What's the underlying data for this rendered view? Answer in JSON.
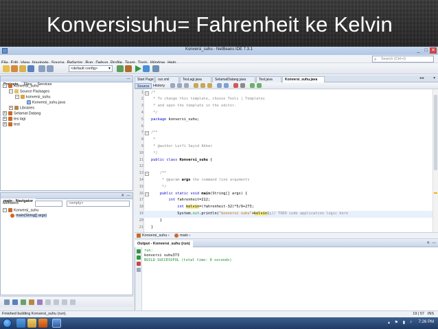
{
  "slide": {
    "title": "Konversisuhu= Fahrenheit ke Kelvin"
  },
  "window": {
    "title": "Konversi_suhu - NetBeans IDE 7.3.1",
    "minimize": "_",
    "maximize": "□",
    "close": "✕"
  },
  "menu": [
    "File",
    "Edit",
    "View",
    "Navigate",
    "Source",
    "Refactor",
    "Run",
    "Debug",
    "Profile",
    "Team",
    "Tools",
    "Window",
    "Help"
  ],
  "search": {
    "placeholder": "Search (Ctrl+I)"
  },
  "toolbar": {
    "config": "<default config>"
  },
  "projects_panel": {
    "tabs": [
      "Projects",
      "Files",
      "Services"
    ],
    "tree": [
      {
        "label": "Konversi_suhu",
        "icon": "coffee-icon",
        "depth": 0
      },
      {
        "label": "Source Packages",
        "icon": "folder-icon",
        "depth": 1
      },
      {
        "label": "konversi_suhu",
        "icon": "package-icon",
        "depth": 2
      },
      {
        "label": "Konversi_suhu.java",
        "icon": "java-file-icon",
        "depth": 3
      },
      {
        "label": "Libraries",
        "icon": "library-icon",
        "depth": 1
      },
      {
        "label": "Selamat Datang",
        "icon": "coffee-icon",
        "depth": 0
      },
      {
        "label": "tes lagi",
        "icon": "coffee-icon",
        "depth": 0
      },
      {
        "label": "test",
        "icon": "coffee-icon",
        "depth": 0
      }
    ]
  },
  "navigator_panel": {
    "title": "main - Navigator",
    "filter_label": "Members",
    "filter_value": "<empty>",
    "tree": [
      {
        "label": "Konversi_suhu",
        "depth": 0
      },
      {
        "label": "main(String[] args)",
        "depth": 1
      }
    ]
  },
  "editor": {
    "tabs": [
      "Start Page",
      "run.xml",
      "TesLagi.java",
      "SelamatDatang.java",
      "Test.java",
      "Konversi_suhu.java"
    ],
    "active_tab": "Konversi_suhu.java",
    "sub_tabs": [
      "Source",
      "History"
    ],
    "lines": [
      {
        "n": "1",
        "fold": "−",
        "parts": [
          {
            "t": "/*",
            "c": "tok-comment"
          }
        ]
      },
      {
        "n": "2",
        "fold": "",
        "parts": [
          {
            "t": " * To change this template, choose Tools | Templates",
            "c": "tok-comment"
          }
        ]
      },
      {
        "n": "3",
        "fold": "",
        "parts": [
          {
            "t": " * and open the template in the editor.",
            "c": "tok-comment"
          }
        ]
      },
      {
        "n": "4",
        "fold": "",
        "parts": [
          {
            "t": " */",
            "c": "tok-comment"
          }
        ]
      },
      {
        "n": "5",
        "fold": "",
        "parts": [
          {
            "t": "package",
            "c": "tok-kw"
          },
          {
            "t": " konversi_suhu;",
            "c": ""
          }
        ]
      },
      {
        "n": "6",
        "fold": "",
        "parts": []
      },
      {
        "n": "7",
        "fold": "−",
        "parts": [
          {
            "t": "/**",
            "c": "tok-comment"
          }
        ]
      },
      {
        "n": "8",
        "fold": "",
        "parts": [
          {
            "t": " *",
            "c": "tok-comment"
          }
        ]
      },
      {
        "n": "9",
        "fold": "",
        "parts": [
          {
            "t": " * @author Lutfi Sayid Akbar",
            "c": "tok-comment"
          }
        ]
      },
      {
        "n": "10",
        "fold": "",
        "parts": [
          {
            "t": " */",
            "c": "tok-comment"
          }
        ]
      },
      {
        "n": "11",
        "fold": "",
        "parts": [
          {
            "t": "public class",
            "c": "tok-kw"
          },
          {
            "t": " ",
            "c": ""
          },
          {
            "t": "Konversi_suhu",
            "c": "tok-cls"
          },
          {
            "t": " {",
            "c": ""
          }
        ]
      },
      {
        "n": "12",
        "fold": "",
        "parts": []
      },
      {
        "n": "13",
        "fold": "−",
        "parts": [
          {
            "t": "    /**",
            "c": "tok-comment"
          }
        ]
      },
      {
        "n": "14",
        "fold": "",
        "parts": [
          {
            "t": "     * @param ",
            "c": "tok-comment"
          },
          {
            "t": "args",
            "c": "tok-cls"
          },
          {
            "t": " the command line arguments",
            "c": "tok-comment"
          }
        ]
      },
      {
        "n": "15",
        "fold": "",
        "parts": [
          {
            "t": "     */",
            "c": "tok-comment"
          }
        ]
      },
      {
        "n": "16",
        "fold": "−",
        "parts": [
          {
            "t": "    public static void",
            "c": "tok-kw"
          },
          {
            "t": " ",
            "c": ""
          },
          {
            "t": "main",
            "c": "tok-cls"
          },
          {
            "t": "(String[] args) {",
            "c": ""
          }
        ]
      },
      {
        "n": "17",
        "fold": "",
        "parts": [
          {
            "t": "        int",
            "c": "tok-kw"
          },
          {
            "t": " fahrenheit=212;",
            "c": ""
          }
        ]
      },
      {
        "n": "18",
        "fold": "",
        "parts": [
          {
            "t": "            int",
            "c": "tok-kw"
          },
          {
            "t": " ",
            "c": ""
          },
          {
            "t": "kelvin",
            "c": "hl"
          },
          {
            "t": "=(fahrenheit-32)*5/9+273;",
            "c": ""
          }
        ]
      },
      {
        "n": "19",
        "fold": "",
        "current": true,
        "parts": [
          {
            "t": "            System.",
            "c": ""
          },
          {
            "t": "out",
            "c": "tok-field"
          },
          {
            "t": ".println(",
            "c": ""
          },
          {
            "t": "\"konversi suhu\"",
            "c": "tok-str"
          },
          {
            "t": "+",
            "c": ""
          },
          {
            "t": "kelvin",
            "c": "hl"
          },
          {
            "t": ");",
            "c": ""
          },
          {
            "t": "// TODO code application logic here",
            "c": "tok-comment"
          }
        ]
      },
      {
        "n": "20",
        "fold": "",
        "parts": [
          {
            "t": "    }",
            "c": ""
          }
        ]
      },
      {
        "n": "21",
        "fold": "",
        "parts": [
          {
            "t": "}",
            "c": ""
          }
        ]
      }
    ]
  },
  "breadcrumb": [
    "Konversi_suhu",
    "main"
  ],
  "output": {
    "title": "Output - Konversi_suhu (run)",
    "lines": [
      {
        "t": "run:",
        "c": "out-muted"
      },
      {
        "t": "konversi suhu373",
        "c": ""
      },
      {
        "t": "BUILD SUCCESSFUL (total time: 0 seconds)",
        "c": "out-success"
      }
    ]
  },
  "status": {
    "message": "Finished building Konversi_suhu (run).",
    "position": "19 | 57",
    "mode": "INS"
  },
  "taskbar": {
    "time": "7:26 PM"
  },
  "colors": {
    "accent": "#2f5c9a",
    "success": "#1d8a2e",
    "keyword": "#0000c8",
    "highlight": "#f7ee8a"
  }
}
